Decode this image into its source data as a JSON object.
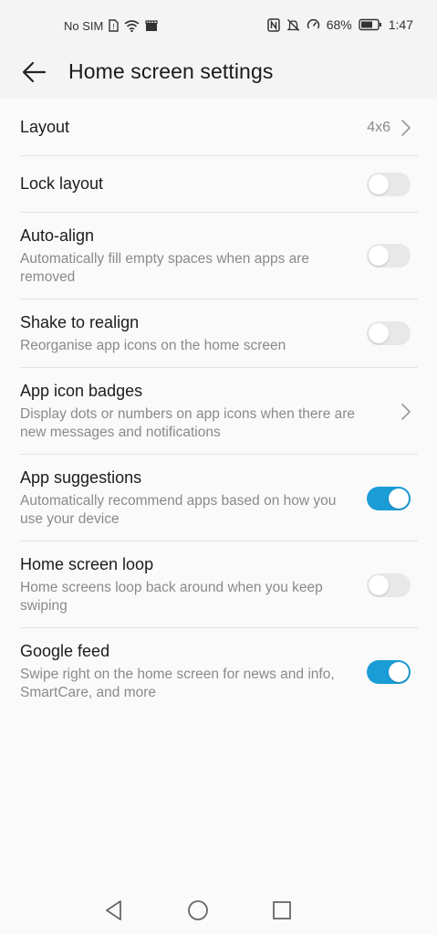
{
  "status_bar": {
    "carrier": "No SIM",
    "battery_percent": "68%",
    "time": "1:47"
  },
  "header": {
    "title": "Home screen settings"
  },
  "settings": {
    "layout": {
      "title": "Layout",
      "value": "4x6"
    },
    "lock_layout": {
      "title": "Lock layout",
      "enabled": false
    },
    "auto_align": {
      "title": "Auto-align",
      "subtitle": "Automatically fill empty spaces when apps are removed",
      "enabled": false
    },
    "shake_to_realign": {
      "title": "Shake to realign",
      "subtitle": "Reorganise app icons on the home screen",
      "enabled": false
    },
    "app_icon_badges": {
      "title": "App icon badges",
      "subtitle": "Display dots or numbers on app icons when there are new messages and notifications"
    },
    "app_suggestions": {
      "title": "App suggestions",
      "subtitle": "Automatically recommend apps based on how you use your device",
      "enabled": true
    },
    "home_screen_loop": {
      "title": "Home screen loop",
      "subtitle": "Home screens loop back around when you keep swiping",
      "enabled": false
    },
    "google_feed": {
      "title": "Google feed",
      "subtitle": "Swipe right on the home screen for news and info, SmartCare, and more",
      "enabled": true
    }
  },
  "colors": {
    "accent": "#1a9cd6",
    "toggle_off": "#e8e8e8",
    "subtitle_gray": "#8a8a8a"
  },
  "icons": [
    "sim-missing-icon",
    "wifi-icon",
    "clapper-icon",
    "nfc-icon",
    "mute-icon",
    "speed-icon",
    "battery-icon",
    "back-arrow-icon",
    "chevron-right-icon",
    "nav-back-icon",
    "nav-home-icon",
    "nav-recents-icon"
  ]
}
